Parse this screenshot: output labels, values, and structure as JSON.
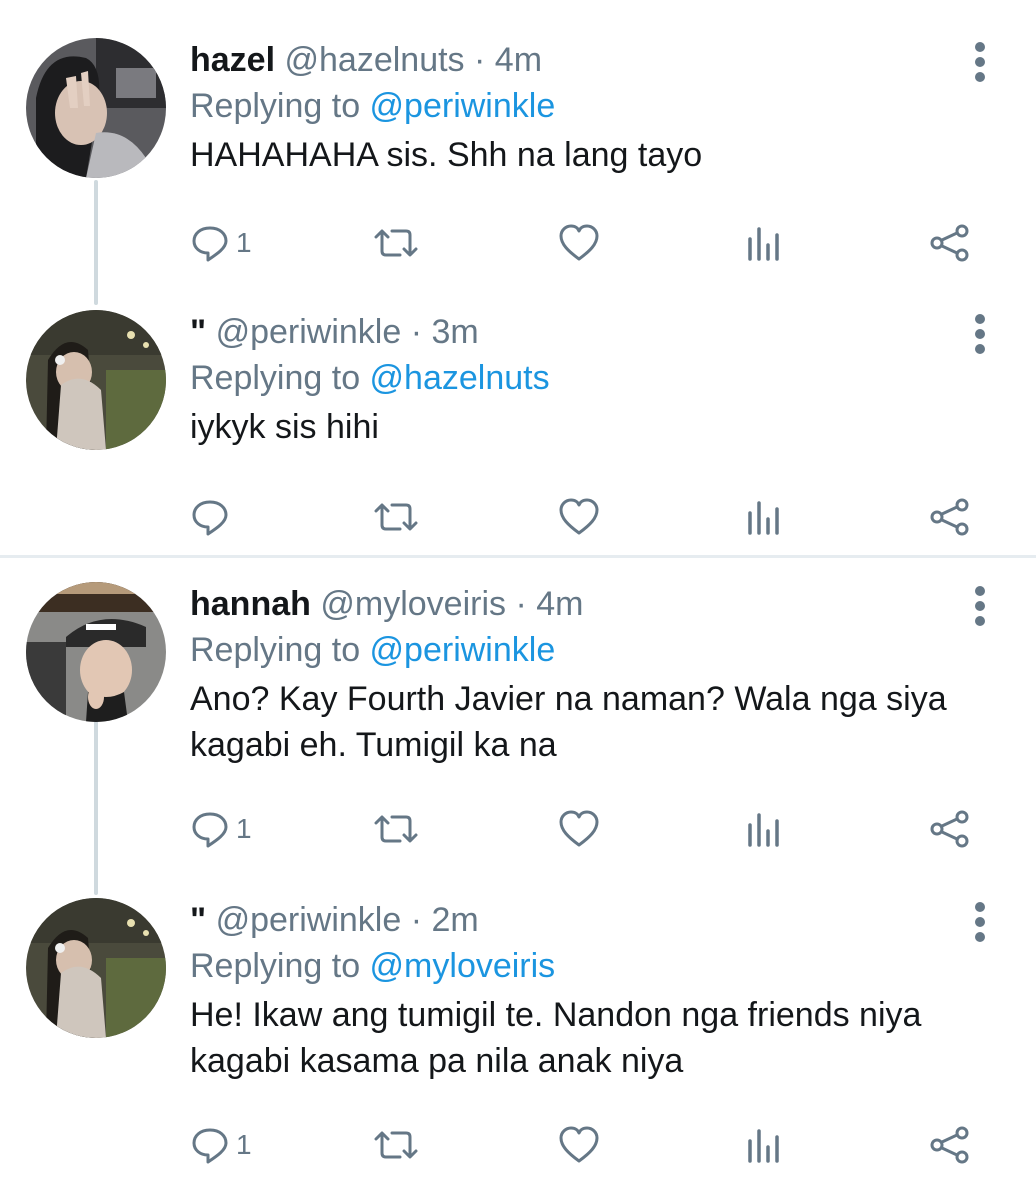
{
  "tweets": [
    {
      "name": "hazel",
      "handle": "@hazelnuts",
      "sep": "·",
      "time": "4m",
      "replying_prefix": "Replying to ",
      "replying_to": "@periwinkle",
      "text": "HAHAHAHA sis. Shh na lang tayo",
      "reply_count": "1"
    },
    {
      "name": "\"",
      "handle": "@periwinkle",
      "sep": "·",
      "time": "3m",
      "replying_prefix": "Replying to ",
      "replying_to": "@hazelnuts",
      "text": "iykyk sis hihi",
      "reply_count": ""
    },
    {
      "name": "hannah",
      "handle": "@myloveiris",
      "sep": "·",
      "time": "4m",
      "replying_prefix": "Replying to ",
      "replying_to": "@periwinkle",
      "text": "Ano? Kay Fourth Javier na naman? Wala nga siya kagabi eh. Tumigil ka na",
      "reply_count": "1"
    },
    {
      "name": "\"",
      "handle": "@periwinkle",
      "sep": "·",
      "time": "2m",
      "replying_prefix": "Replying to ",
      "replying_to": "@myloveiris",
      "text": "He! Ikaw ang tumigil te. Nandon nga friends niya kagabi kasama pa nila anak niya",
      "reply_count": "1"
    }
  ],
  "icons": {
    "reply": "speech-bubble-icon",
    "retweet": "retweet-icon",
    "like": "heart-icon",
    "analytics": "bar-chart-icon",
    "share": "share-icon",
    "more": "vertical-ellipsis-icon"
  },
  "colors": {
    "link": "#1b95e0",
    "muted": "#657786",
    "thread_line": "#cfd9de",
    "divider": "#e6ecf0"
  }
}
